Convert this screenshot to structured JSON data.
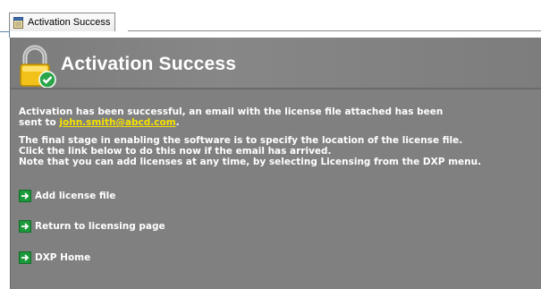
{
  "tab": {
    "title": "Activation Success",
    "icon": "document-icon"
  },
  "header": {
    "title": "Activation Success",
    "icon": "lock-check-icon"
  },
  "message": {
    "line1": "Activation has been successful, an email with the license file attached has been",
    "line2_prefix": "sent to ",
    "email": "john.smith@abcd.com",
    "line2_suffix": ".",
    "line3": "The final stage in enabling the software is to specify the location of the license file.",
    "line4": "Click the link below to do this now if the email has arrived.",
    "line5": "Note that you can add licenses at any time, by selecting Licensing from the DXP menu."
  },
  "links": [
    {
      "label": "Add license file",
      "icon": "arrow-right-icon"
    },
    {
      "label": "Return to licensing page",
      "icon": "arrow-right-icon"
    },
    {
      "label": "DXP Home",
      "icon": "arrow-right-icon"
    }
  ],
  "colors": {
    "panel": "#808080",
    "link_email": "#f5e100",
    "arrow_green": "#1c9a3b",
    "text": "#ffffff"
  }
}
